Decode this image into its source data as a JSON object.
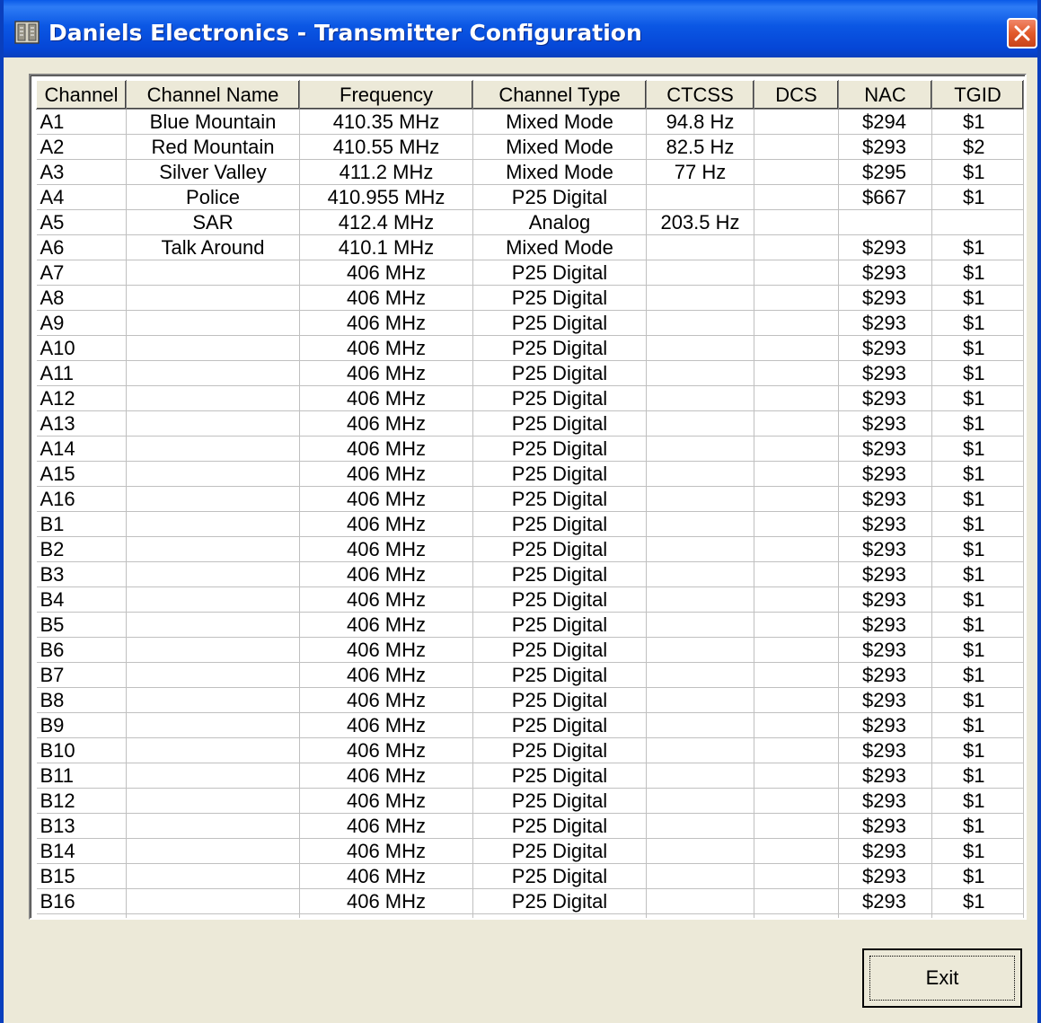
{
  "window": {
    "title": "Daniels Electronics - Transmitter Configuration",
    "app_icon": "radio-icon",
    "close_icon": "close-icon",
    "titlebar_color": "#0a55e3",
    "close_color": "#e25a2c"
  },
  "table": {
    "columns": [
      "Channel",
      "Channel Name",
      "Frequency",
      "Channel Type",
      "CTCSS",
      "DCS",
      "NAC",
      "TGID"
    ],
    "rows": [
      [
        "A1",
        "Blue Mountain",
        "410.35 MHz",
        "Mixed Mode",
        "94.8 Hz",
        "",
        "$294",
        "$1"
      ],
      [
        "A2",
        "Red Mountain",
        "410.55 MHz",
        "Mixed Mode",
        "82.5 Hz",
        "",
        "$293",
        "$2"
      ],
      [
        "A3",
        "Silver Valley",
        "411.2 MHz",
        "Mixed Mode",
        "77 Hz",
        "",
        "$295",
        "$1"
      ],
      [
        "A4",
        "Police",
        "410.955 MHz",
        "P25 Digital",
        "",
        "",
        "$667",
        "$1"
      ],
      [
        "A5",
        "SAR",
        "412.4 MHz",
        "Analog",
        "203.5 Hz",
        "",
        "",
        ""
      ],
      [
        "A6",
        "Talk Around",
        "410.1 MHz",
        "Mixed Mode",
        "",
        "",
        "$293",
        "$1"
      ],
      [
        "A7",
        "",
        "406 MHz",
        "P25 Digital",
        "",
        "",
        "$293",
        "$1"
      ],
      [
        "A8",
        "",
        "406 MHz",
        "P25 Digital",
        "",
        "",
        "$293",
        "$1"
      ],
      [
        "A9",
        "",
        "406 MHz",
        "P25 Digital",
        "",
        "",
        "$293",
        "$1"
      ],
      [
        "A10",
        "",
        "406 MHz",
        "P25 Digital",
        "",
        "",
        "$293",
        "$1"
      ],
      [
        "A11",
        "",
        "406 MHz",
        "P25 Digital",
        "",
        "",
        "$293",
        "$1"
      ],
      [
        "A12",
        "",
        "406 MHz",
        "P25 Digital",
        "",
        "",
        "$293",
        "$1"
      ],
      [
        "A13",
        "",
        "406 MHz",
        "P25 Digital",
        "",
        "",
        "$293",
        "$1"
      ],
      [
        "A14",
        "",
        "406 MHz",
        "P25 Digital",
        "",
        "",
        "$293",
        "$1"
      ],
      [
        "A15",
        "",
        "406 MHz",
        "P25 Digital",
        "",
        "",
        "$293",
        "$1"
      ],
      [
        "A16",
        "",
        "406 MHz",
        "P25 Digital",
        "",
        "",
        "$293",
        "$1"
      ],
      [
        "B1",
        "",
        "406 MHz",
        "P25 Digital",
        "",
        "",
        "$293",
        "$1"
      ],
      [
        "B2",
        "",
        "406 MHz",
        "P25 Digital",
        "",
        "",
        "$293",
        "$1"
      ],
      [
        "B3",
        "",
        "406 MHz",
        "P25 Digital",
        "",
        "",
        "$293",
        "$1"
      ],
      [
        "B4",
        "",
        "406 MHz",
        "P25 Digital",
        "",
        "",
        "$293",
        "$1"
      ],
      [
        "B5",
        "",
        "406 MHz",
        "P25 Digital",
        "",
        "",
        "$293",
        "$1"
      ],
      [
        "B6",
        "",
        "406 MHz",
        "P25 Digital",
        "",
        "",
        "$293",
        "$1"
      ],
      [
        "B7",
        "",
        "406 MHz",
        "P25 Digital",
        "",
        "",
        "$293",
        "$1"
      ],
      [
        "B8",
        "",
        "406 MHz",
        "P25 Digital",
        "",
        "",
        "$293",
        "$1"
      ],
      [
        "B9",
        "",
        "406 MHz",
        "P25 Digital",
        "",
        "",
        "$293",
        "$1"
      ],
      [
        "B10",
        "",
        "406 MHz",
        "P25 Digital",
        "",
        "",
        "$293",
        "$1"
      ],
      [
        "B11",
        "",
        "406 MHz",
        "P25 Digital",
        "",
        "",
        "$293",
        "$1"
      ],
      [
        "B12",
        "",
        "406 MHz",
        "P25 Digital",
        "",
        "",
        "$293",
        "$1"
      ],
      [
        "B13",
        "",
        "406 MHz",
        "P25 Digital",
        "",
        "",
        "$293",
        "$1"
      ],
      [
        "B14",
        "",
        "406 MHz",
        "P25 Digital",
        "",
        "",
        "$293",
        "$1"
      ],
      [
        "B15",
        "",
        "406 MHz",
        "P25 Digital",
        "",
        "",
        "$293",
        "$1"
      ],
      [
        "B16",
        "",
        "406 MHz",
        "P25 Digital",
        "",
        "",
        "$293",
        "$1"
      ]
    ]
  },
  "buttons": {
    "exit_label": "Exit"
  }
}
